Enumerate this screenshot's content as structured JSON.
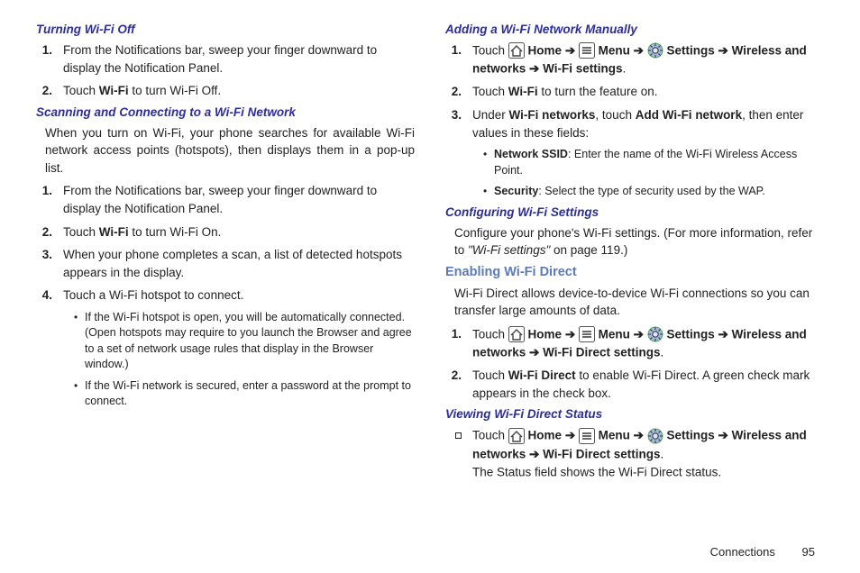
{
  "left": {
    "h1": "Turning Wi-Fi Off",
    "l1": {
      "n1": "1.",
      "t1": "From the Notifications bar, sweep your finger downward to display the Notification Panel.",
      "n2": "2.",
      "t2a": "Touch ",
      "t2b": "Wi-Fi",
      "t2c": " to turn Wi-Fi Off."
    },
    "h2": "Scanning and Connecting to a Wi-Fi Network",
    "p1": "When you turn on Wi-Fi, your phone searches for available Wi-Fi network access points (hotspots), then displays them in a pop-up list.",
    "l2": {
      "n1": "1.",
      "t1": "From the Notifications bar, sweep your finger downward to display the Notification Panel.",
      "n2": "2.",
      "t2a": "Touch ",
      "t2b": "Wi-Fi",
      "t2c": " to turn Wi-Fi On.",
      "n3": "3.",
      "t3": "When your phone completes a scan, a list of detected hotspots appears in the display.",
      "n4": "4.",
      "t4": "Touch a Wi-Fi hotspot to connect.",
      "b1": "If the Wi-Fi hotspot is open, you will be automatically connected. (Open hotspots may require to you launch the Browser and agree to a set of network usage rules that display in the Browser window.)",
      "b2": "If the Wi-Fi network is secured, enter a password at the prompt to connect."
    }
  },
  "right": {
    "h1": "Adding a Wi-Fi Network Manually",
    "nav": {
      "touch": "Touch ",
      "home": " Home ",
      "arrow": "➔",
      "menu": " Menu ",
      "settings": " Settings ",
      "wn": "Wireless and networks",
      "wfs": "Wi-Fi settings",
      "wfds": "Wi-Fi Direct settings",
      "dot": "."
    },
    "l1": {
      "n1": "1.",
      "n2": "2.",
      "t2a": "Touch ",
      "t2b": "Wi-Fi",
      "t2c": " to turn the feature on.",
      "n3": "3.",
      "t3a": "Under ",
      "t3b": "Wi-Fi networks",
      "t3c": ", touch ",
      "t3d": "Add Wi-Fi network",
      "t3e": ", then enter values in these fields:",
      "b1a": "Network SSID",
      "b1b": ": Enter the name of the Wi-Fi Wireless Access Point.",
      "b2a": "Security",
      "b2b": ": Select the type of security used by the WAP."
    },
    "h2": "Configuring Wi-Fi Settings",
    "p2a": "Configure your phone's Wi-Fi settings. (For more information, refer to ",
    "p2b": "\"Wi-Fi settings\"",
    "p2c": "  on page 119.)",
    "h3": "Enabling Wi-Fi Direct",
    "p3": "Wi-Fi Direct allows device-to-device Wi-Fi connections so you can transfer large amounts of data.",
    "l2": {
      "n1": "1.",
      "n2": "2.",
      "t2a": "Touch ",
      "t2b": "Wi-Fi Direct",
      "t2c": " to enable Wi-Fi Direct. A green check mark appears in the check box."
    },
    "h4": "Viewing Wi-Fi Direct Status",
    "p4": "The Status field shows the Wi-Fi Direct status."
  },
  "footer": {
    "section": "Connections",
    "page": "95"
  }
}
